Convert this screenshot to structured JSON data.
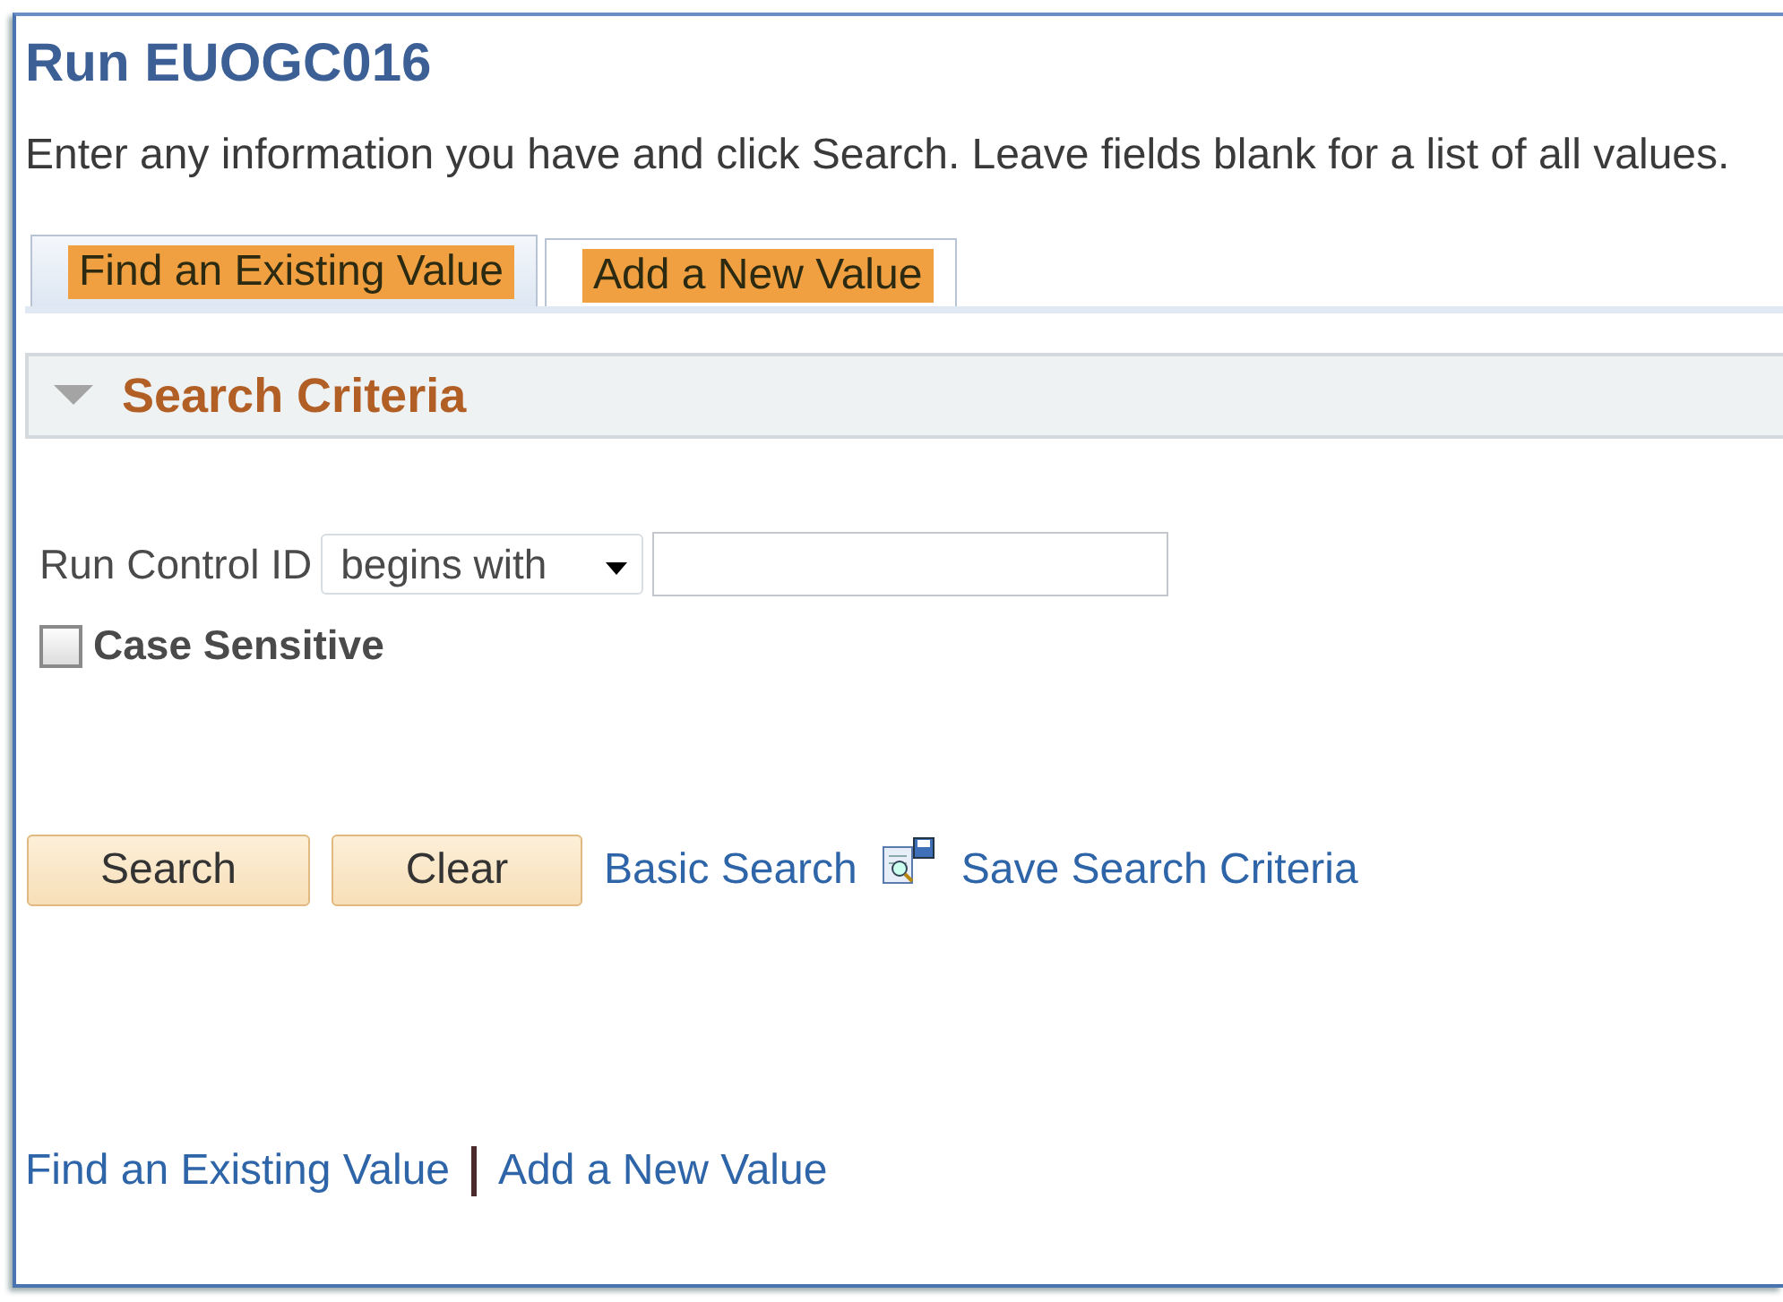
{
  "page": {
    "title": "Run EUOGC016",
    "instructions": "Enter any information you have and click Search. Leave fields blank for a list of all values."
  },
  "tabs": [
    {
      "label": "Find an Existing Value",
      "selected": true
    },
    {
      "label": "Add a New Value",
      "selected": false
    }
  ],
  "section": {
    "title": "Search Criteria",
    "expanded": true
  },
  "criteria": {
    "label": "Run Control ID",
    "operator": "begins with"
  },
  "case_sensitive": {
    "label": "Case Sensitive",
    "checked": false
  },
  "buttons": [
    "Search",
    "Clear"
  ],
  "links": [
    "Basic Search",
    "Save Search Criteria"
  ],
  "footer_links": [
    "Find an Existing Value",
    "Add a New Value"
  ]
}
